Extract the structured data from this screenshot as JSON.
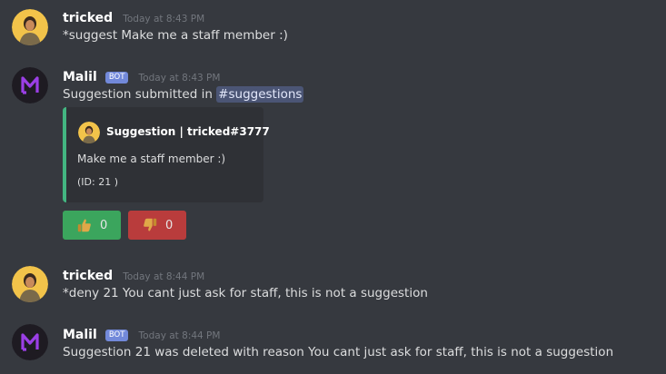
{
  "messages": [
    {
      "username": "tricked",
      "time": "Today at 8:43 PM",
      "text": "*suggest Make me a staff member :)"
    },
    {
      "username": "Malil",
      "bot_tag": "BOT",
      "time": "Today at 8:43 PM",
      "text_prefix": "Suggestion submitted in",
      "channel_mention": "#suggestions",
      "embed": {
        "accent_color": "#43b581",
        "author": "Suggestion | tricked#3777",
        "description": "Make me a staff member :)",
        "id_text": "(ID: 21 )"
      },
      "reactions": [
        {
          "icon": "thumbs-up",
          "count": "0",
          "color": "#3ba55d"
        },
        {
          "icon": "thumbs-down",
          "count": "0",
          "color": "#b93c3c"
        }
      ]
    },
    {
      "username": "tricked",
      "time": "Today at 8:44 PM",
      "text": "*deny 21 You cant just ask for staff, this is not a suggestion"
    },
    {
      "username": "Malil",
      "bot_tag": "BOT",
      "time": "Today at 8:44 PM",
      "text": "Suggestion 21 was deleted with reason You cant just ask for staff, this is not a suggestion"
    }
  ],
  "colors": {
    "background": "#36393f",
    "embed_background": "#2f3136",
    "bot_tag": "#7289da",
    "timestamp": "#72767d"
  }
}
